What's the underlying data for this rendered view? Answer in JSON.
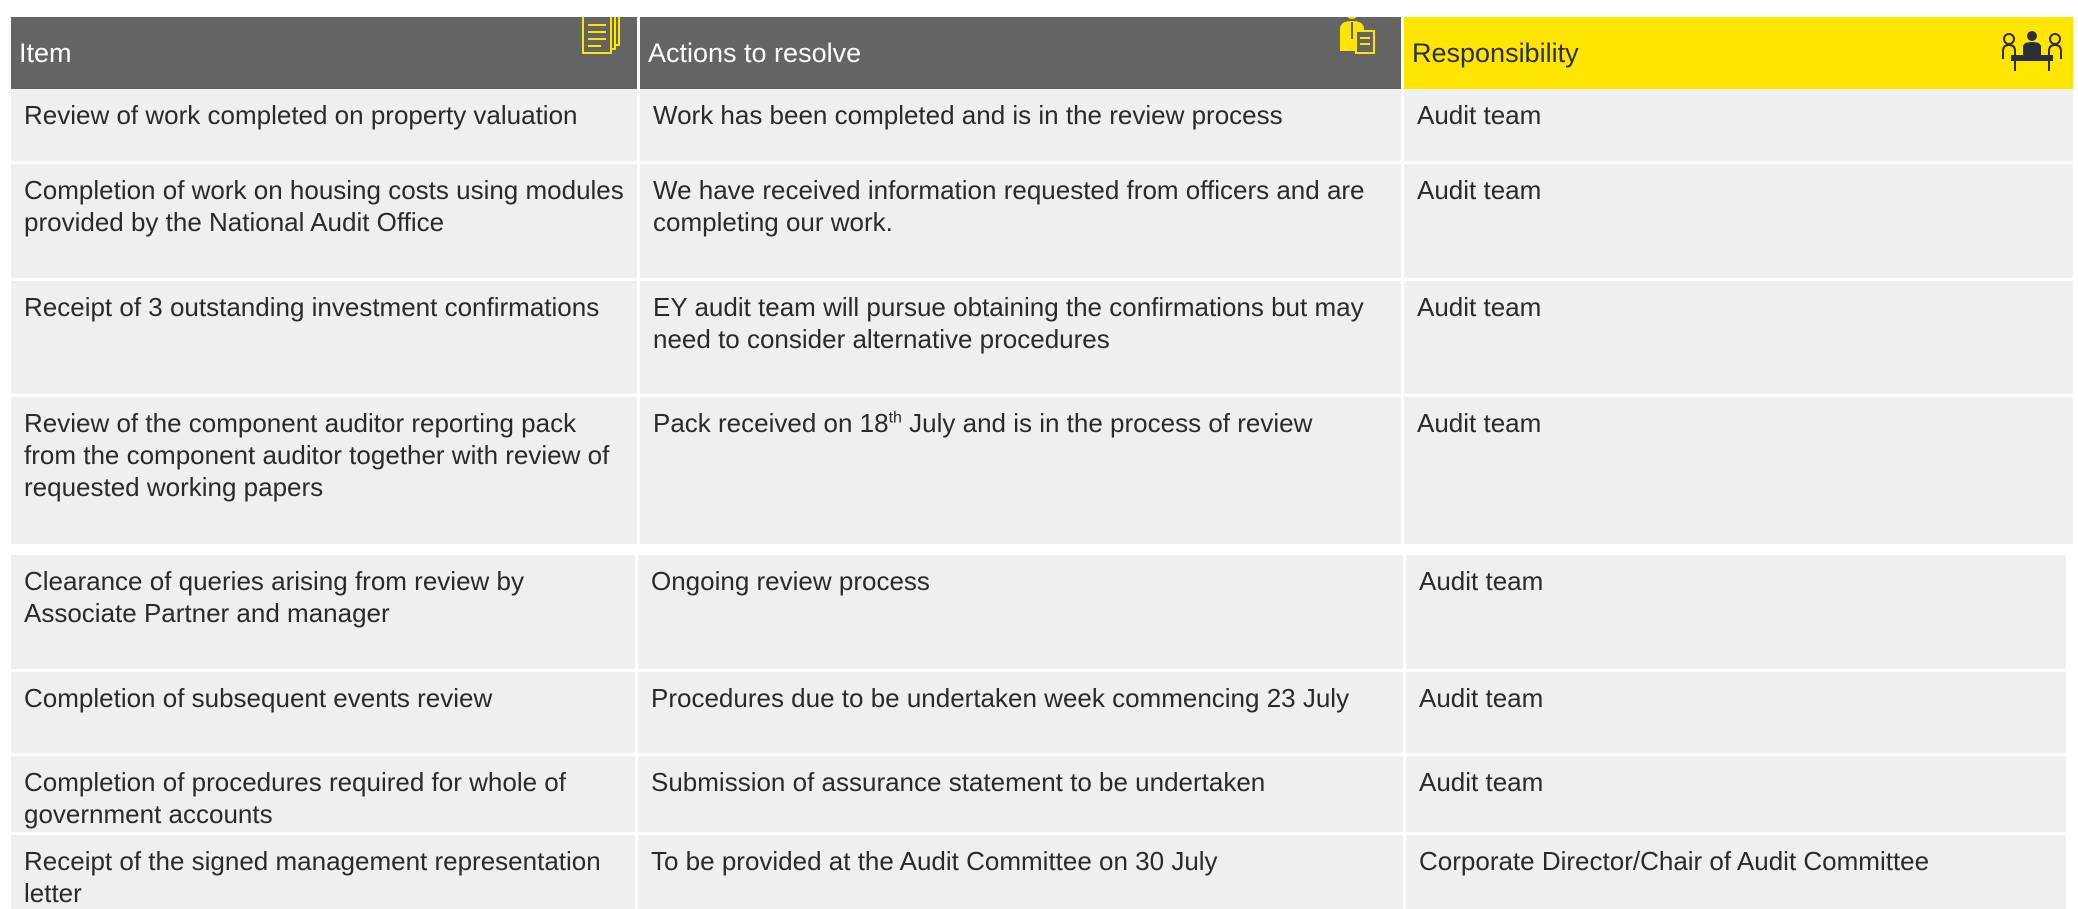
{
  "header": {
    "item": "Item",
    "actions": "Actions to resolve",
    "responsibility": "Responsibility"
  },
  "icons": {
    "item": "documents-icon",
    "actions": "person-with-document-icon",
    "responsibility": "meeting-group-icon"
  },
  "colors": {
    "header_gray": "#646464",
    "header_yellow": "#ffe600",
    "cell_bg": "#efefef",
    "text": "#2a2a2a"
  },
  "table1": [
    {
      "item": "Review of work completed on property valuation",
      "action": "Work has been completed and is in the review process",
      "responsibility": "Audit team"
    },
    {
      "item": "Completion of work on housing costs using modules provided by the National Audit Office",
      "action": "We have received information requested from officers and are completing our work.",
      "responsibility": "Audit team"
    },
    {
      "item": "Receipt of 3 outstanding investment confirmations",
      "action": "EY audit team will pursue obtaining the confirmations but may need to consider alternative procedures",
      "responsibility": "Audit team"
    },
    {
      "item": "Review of the component auditor reporting pack from the component auditor together with review of  requested working papers",
      "action_pre": "Pack received on 18",
      "action_sup": "th",
      "action_post": " July and is in the process of review",
      "responsibility": "Audit team"
    }
  ],
  "table2": [
    {
      "item": "Clearance of queries arising from review by Associate Partner and manager",
      "action": "Ongoing review process",
      "responsibility": "Audit team"
    },
    {
      "item": "Completion of subsequent events review",
      "action": "Procedures due to be undertaken week commencing 23 July",
      "responsibility": "Audit team"
    },
    {
      "item": "Completion of procedures required for whole of government accounts",
      "action": "Submission of assurance statement to be undertaken",
      "responsibility": "Audit team"
    },
    {
      "item": "Receipt of the signed management representation letter",
      "action": "To be provided at the Audit Committee on 30 July",
      "responsibility": "Corporate Director/Chair of Audit Committee"
    }
  ]
}
